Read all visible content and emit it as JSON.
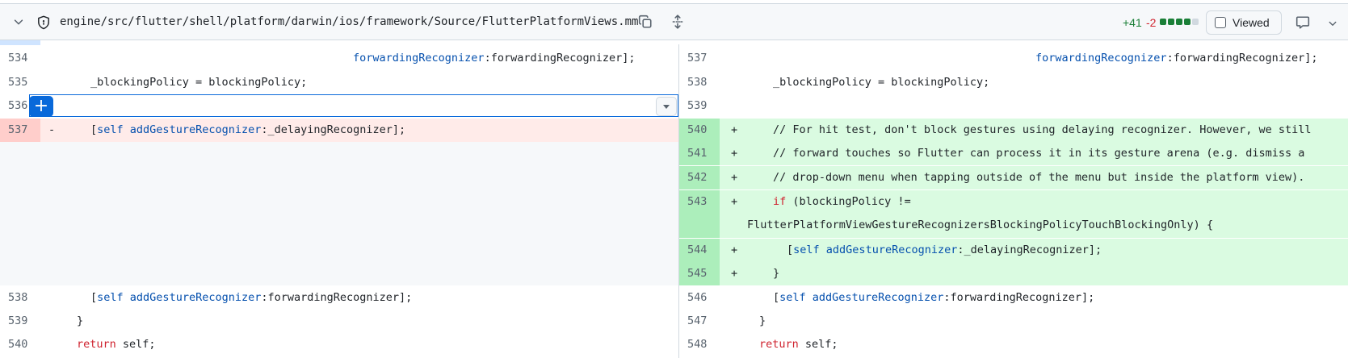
{
  "file_header": {
    "path": "engine/src/flutter/shell/platform/darwin/ios/framework/Source/FlutterPlatformViews.mm",
    "additions": "+41",
    "deletions": "-2",
    "diffstat_blocks": [
      "added",
      "added",
      "added",
      "added",
      "neutral"
    ],
    "viewed_label": "Viewed",
    "icons": {
      "collapse": "chevron-down-icon",
      "file": "shield-icon",
      "copy": "copy-icon",
      "expand": "unfold-icon",
      "comment": "comment-icon",
      "more": "chevron-down-icon"
    }
  },
  "colors": {
    "addition_text": "#1a7f37",
    "deletion_text": "#d1242f",
    "added_line_bg": "#dafbe1",
    "added_number_bg": "#aceebb",
    "deleted_line_bg": "#ffebe9",
    "deleted_number_bg": "#ffcecb",
    "accent": "#0969da"
  },
  "left": {
    "l534": "534",
    "l535": "535",
    "l536": "536",
    "l537": "537",
    "l538": "538",
    "l539": "539",
    "l540": "540",
    "del_marker": "-"
  },
  "right": {
    "l537": "537",
    "l538": "538",
    "l539": "539",
    "l540": "540",
    "l541": "541",
    "l542": "542",
    "l543": "543",
    "l544": "544",
    "l545": "545",
    "l546": "546",
    "l547": "547",
    "l548": "548",
    "add_marker": "+"
  },
  "code": {
    "fwd_method": "forwardingRecognizer",
    "fwd_arg": ":forwardingRecognizer];",
    "blocking_assign": "_blockingPolicy = blockingPolicy;",
    "open_bracket": "[",
    "self_kw": "self",
    "add_gesture": "addGestureRecognizer",
    "delaying_arg": ":_delayingRecognizer];",
    "fwd_arg2": ":forwardingRecognizer];",
    "comment_1": "// For hit test, don't block gestures using delaying recognizer. However, we still",
    "comment_2": "// forward touches so Flutter can process it in its gesture arena (e.g. dismiss a",
    "comment_3": "// drop-down menu when tapping outside of the menu but inside the platform view).",
    "if_kw": "if",
    "if_cond": " (blockingPolicy !=",
    "if_cont": "FlutterPlatformViewGestureRecognizersBlockingPolicyTouchBlockingOnly) {",
    "close_brace": "}",
    "return_kw": "return",
    "return_rest": " self;"
  },
  "plus_glyph": "+"
}
